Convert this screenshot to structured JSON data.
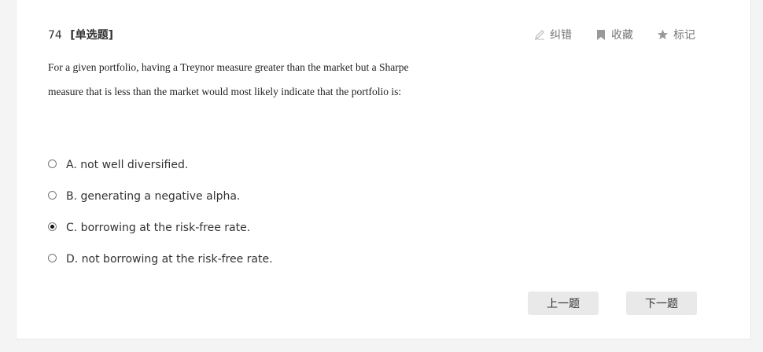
{
  "question": {
    "number": "74",
    "type_label": "[单选题]",
    "stem_line1": "For a given portfolio, having a Treynor measure greater than the market but a Sharpe",
    "stem_line2": "measure that is less than the market would most likely indicate that the portfolio is:"
  },
  "tools": {
    "correct_label": "纠错",
    "correct_icon": "pencil-icon",
    "favorite_label": "收藏",
    "favorite_icon": "bookmark-icon",
    "mark_label": "标记",
    "mark_icon": "star-icon"
  },
  "options": [
    {
      "label": "A. not well diversified.",
      "selected": false
    },
    {
      "label": "B. generating a negative alpha.",
      "selected": false
    },
    {
      "label": "C. borrowing at the risk-free rate.",
      "selected": true
    },
    {
      "label": "D. not borrowing at the risk-free rate.",
      "selected": false
    }
  ],
  "nav": {
    "prev_label": "上一题",
    "next_label": "下一题"
  },
  "colors": {
    "background": "#f4f4f4",
    "card": "#ffffff",
    "button": "#e9e9ea",
    "icon": "#999999"
  }
}
